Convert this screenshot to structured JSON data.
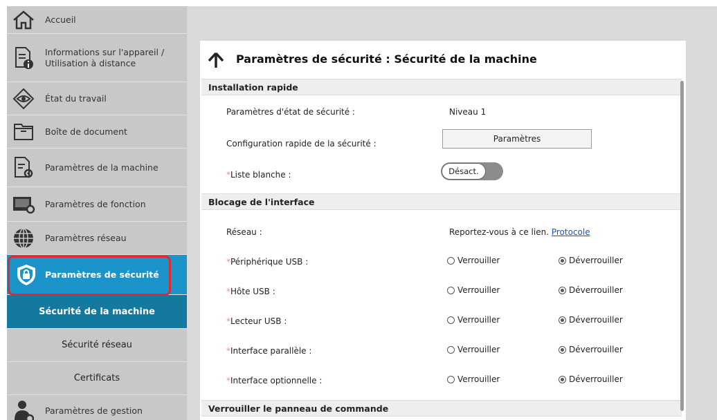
{
  "sidebar": {
    "items": [
      {
        "label": "Accueil",
        "icon": "home-icon"
      },
      {
        "label": "Informations sur l'appareil / Utilisation à distance",
        "icon": "device-info-icon"
      },
      {
        "label": "État du travail",
        "icon": "eye-icon"
      },
      {
        "label": "Boîte de document",
        "icon": "folder-icon"
      },
      {
        "label": "Paramètres de la machine",
        "icon": "machine-settings-icon"
      },
      {
        "label": "Paramètres de fonction",
        "icon": "function-settings-icon"
      },
      {
        "label": "Paramètres réseau",
        "icon": "globe-icon"
      },
      {
        "label": "Paramètres de sécurité",
        "icon": "shield-lock-icon"
      },
      {
        "label": "Paramètres de gestion",
        "icon": "admin-user-icon"
      }
    ],
    "subitems": [
      {
        "label": "Sécurité de la machine"
      },
      {
        "label": "Sécurité réseau"
      },
      {
        "label": "Certificats"
      }
    ]
  },
  "page": {
    "title": "Paramètres de sécurité : Sécurité de la machine",
    "back_icon": "arrow-up-icon"
  },
  "sections": {
    "quick": {
      "title": "Installation rapide",
      "security_status_label": "Paramètres d'état de sécurité :",
      "security_status_value": "Niveau 1",
      "quick_config_label": "Configuration rapide de la sécurité :",
      "quick_config_button": "Paramètres",
      "whitelist_label": "Liste blanche :",
      "whitelist_toggle": "Désact."
    },
    "interface": {
      "title": "Blocage de l'interface",
      "network_label": "Réseau :",
      "network_text": "Reportez-vous à ce lien.",
      "network_link": "Protocole",
      "lock_label": "Verrouiller",
      "unlock_label": "Déverrouiller",
      "rows": [
        {
          "label": "Périphérique USB :",
          "selected": "unlock"
        },
        {
          "label": "Hôte USB :",
          "selected": "unlock"
        },
        {
          "label": "Lecteur USB :",
          "selected": "unlock"
        },
        {
          "label": "Interface parallèle :",
          "selected": "unlock"
        },
        {
          "label": "Interface optionnelle :",
          "selected": "unlock"
        }
      ]
    },
    "panel_lock": {
      "title": "Verrouiller le panneau de commande"
    }
  },
  "required_marker": "*",
  "colors": {
    "accent": "#1a94c9",
    "active_sub": "#14799f",
    "highlight": "#e0282f",
    "link": "#1a52c9"
  }
}
